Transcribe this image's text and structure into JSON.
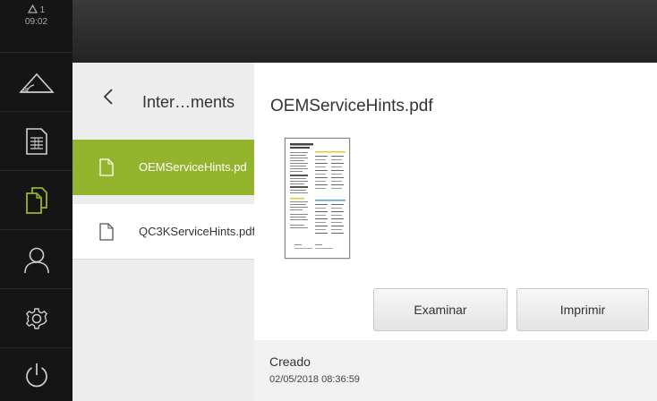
{
  "status": {
    "warning_count": "1",
    "time": "09:02",
    "warning_icon": "warning-triangle-icon"
  },
  "sidebar": {
    "items": [
      {
        "name": "measure",
        "icon": "measure-icon"
      },
      {
        "name": "protocol",
        "icon": "report-icon"
      },
      {
        "name": "file-management",
        "icon": "file-management-icon",
        "active": true
      },
      {
        "name": "user",
        "icon": "user-icon"
      },
      {
        "name": "settings",
        "icon": "gear-icon"
      },
      {
        "name": "power",
        "icon": "power-icon"
      }
    ],
    "active_color": "#95b42d"
  },
  "file_panel": {
    "folder_title": "Inter…ments",
    "files": [
      {
        "name": "OEMServiceHints.pdf",
        "selected": true
      },
      {
        "name": "QC3KServiceHints.pdf",
        "selected": false
      }
    ]
  },
  "details": {
    "title": "OEMServiceHints.pdf",
    "examine_label": "Examinar",
    "print_label": "Imprimir",
    "created_label": "Creado",
    "created_value": "02/05/2018 08:36:59"
  },
  "colors": {
    "accent": "#95b42d",
    "sidebar": "#151515",
    "topbar": "#2e2e2e"
  }
}
